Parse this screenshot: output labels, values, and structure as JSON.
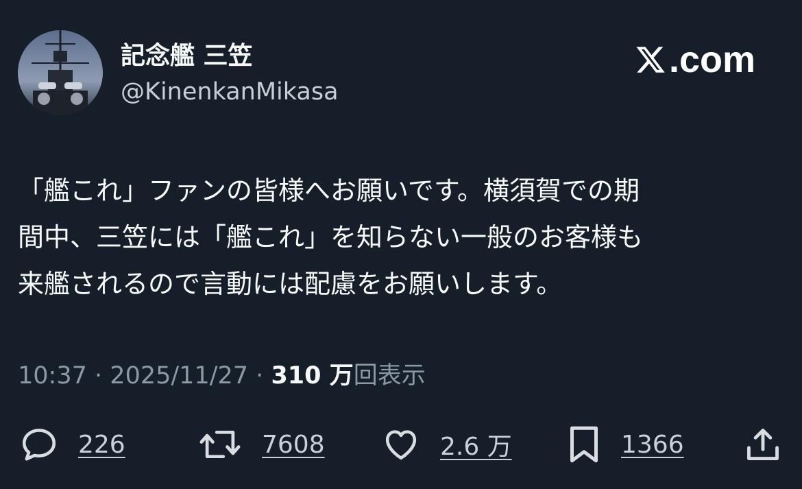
{
  "author": {
    "display_name": "記念艦 三笠",
    "handle": "@KinenkanMikasa",
    "avatar_icon": "battleship-avatar-icon"
  },
  "brand": {
    "icon": "x-logo-icon",
    "text": ".com"
  },
  "tweet": {
    "lines": [
      "「艦これ」ファンの皆様へお願いです。横須賀での期",
      "間中、三笠には「艦これ」を知らない一般のお客様も",
      "来艦されるので言動には配慮をお願いします。"
    ]
  },
  "meta": {
    "time": "10:37",
    "separator": "·",
    "date": "2025/11/27",
    "views_count": "310 万",
    "views_label": "回表示"
  },
  "actions": {
    "reply": {
      "icon": "reply-bubble-icon",
      "count": "226"
    },
    "retweet": {
      "icon": "retweet-icon",
      "count": "7608"
    },
    "like": {
      "icon": "heart-icon",
      "count": "2.6 万"
    },
    "bookmark": {
      "icon": "bookmark-icon",
      "count": "1366"
    },
    "share": {
      "icon": "share-icon"
    }
  },
  "colors": {
    "background": "#161e29",
    "text_primary": "#f7f9f9",
    "text_secondary": "#8b98a5"
  }
}
